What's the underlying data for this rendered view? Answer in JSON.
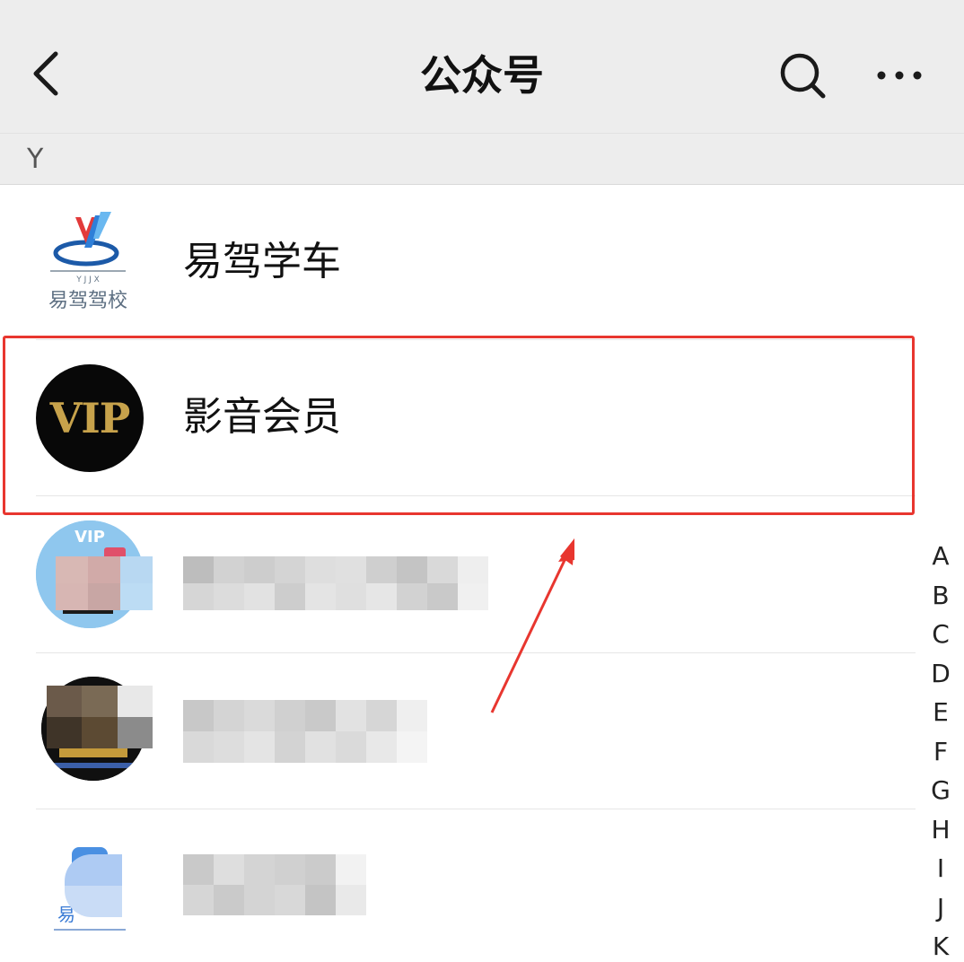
{
  "header": {
    "title": "公众号",
    "back_icon": "chevron-left-icon",
    "search_icon": "search-icon",
    "more_icon": "more-horizontal-icon"
  },
  "section": {
    "letter": "Y"
  },
  "list": {
    "items": [
      {
        "label": "易驾学车",
        "avatar_text": "易驾驾校"
      },
      {
        "label": "影音会员",
        "avatar_text": "VIP"
      },
      {
        "label": "",
        "avatar_text": "VIP"
      },
      {
        "label": ""
      },
      {
        "label": "",
        "avatar_text": "易"
      }
    ]
  },
  "index": [
    "A",
    "B",
    "C",
    "D",
    "E",
    "F",
    "G",
    "H",
    "I",
    "J",
    "K"
  ],
  "colors": {
    "highlight": "#e8362f",
    "header_bg": "#ededed",
    "vip_gold": "#c7a24b"
  }
}
